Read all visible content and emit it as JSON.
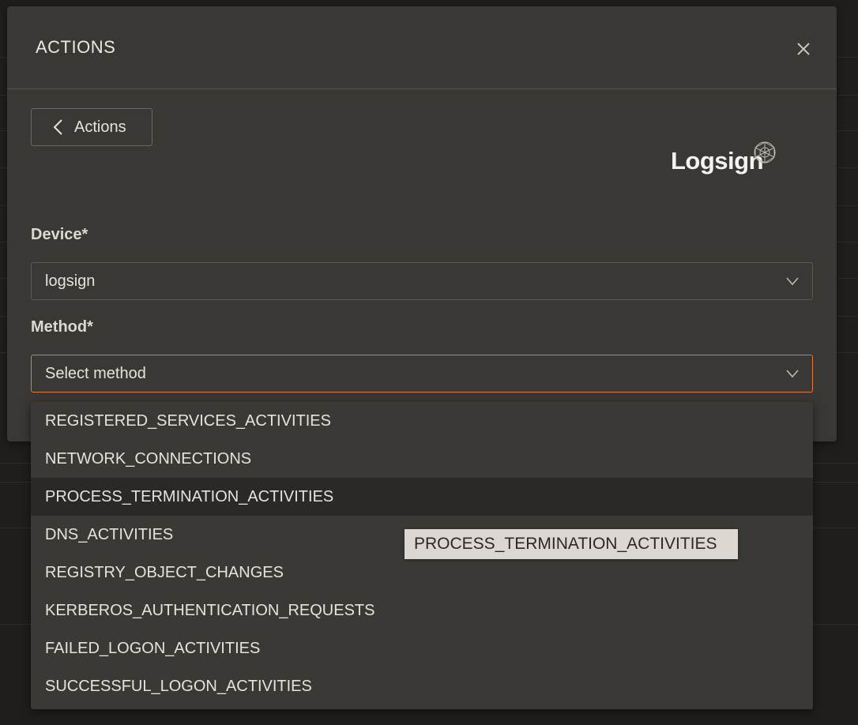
{
  "modal": {
    "title": "ACTIONS",
    "back_label": "Actions",
    "logo_text": "Logsign"
  },
  "form": {
    "device_label": "Device*",
    "device_value": "logsign",
    "method_label": "Method*",
    "method_placeholder": "Select method"
  },
  "method_options": [
    "REGISTERED_SERVICES_ACTIVITIES",
    "NETWORK_CONNECTIONS",
    "PROCESS_TERMINATION_ACTIVITIES",
    "DNS_ACTIVITIES",
    "REGISTRY_OBJECT_CHANGES",
    "KERBEROS_AUTHENTICATION_REQUESTS",
    "FAILED_LOGON_ACTIVITIES",
    "SUCCESSFUL_LOGON_ACTIVITIES"
  ],
  "tooltip": {
    "text": "PROCESS_TERMINATION_ACTIVITIES"
  },
  "colors": {
    "background": "#1f1e1c",
    "modal": "#3a3835",
    "focus_border": "#e07a3a",
    "hover_row": "#2a2927"
  }
}
